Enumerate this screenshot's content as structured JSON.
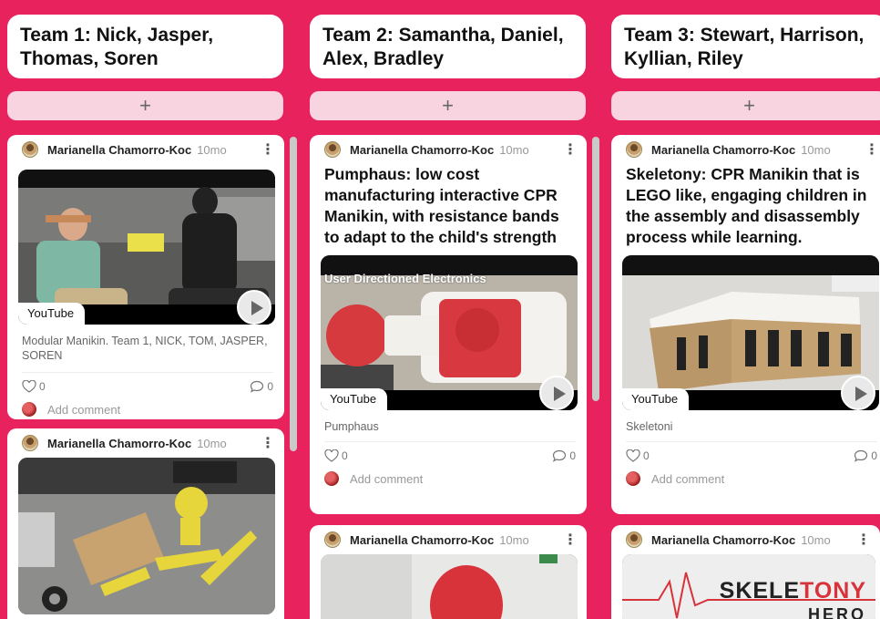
{
  "columns": [
    {
      "title": "Team 1: Nick, Jasper, Thomas, Soren",
      "add_label": "+",
      "posts": [
        {
          "author": "Marianella Chamorro-Koc",
          "time": "10mo",
          "menu": "⋮",
          "media_label": "YouTube",
          "caption": "Modular Manikin. Team 1, NICK, TOM, JASPER, SOREN",
          "likes": "0",
          "comments": "0",
          "add_comment": "Add comment"
        },
        {
          "author": "Marianella Chamorro-Koc",
          "time": "10mo",
          "menu": "⋮"
        }
      ]
    },
    {
      "title": "Team 2: Samantha, Daniel, Alex, Bradley",
      "add_label": "+",
      "posts": [
        {
          "author": "Marianella Chamorro-Koc",
          "time": "10mo",
          "menu": "⋮",
          "title": "Pumphaus: low cost manufacturing interactive CPR Manikin, with resistance bands to adapt to the child's strength",
          "media_overlay": "User Directioned Electronics",
          "media_label": "YouTube",
          "caption": "Pumphaus",
          "likes": "0",
          "comments": "0",
          "add_comment": "Add comment"
        },
        {
          "author": "Marianella Chamorro-Koc",
          "time": "10mo",
          "menu": "⋮"
        }
      ]
    },
    {
      "title": "Team 3: Stewart, Harrison, Kyllian, Riley",
      "add_label": "+",
      "posts": [
        {
          "author": "Marianella Chamorro-Koc",
          "time": "10mo",
          "menu": "⋮",
          "title": "Skeletony: CPR Manikin that is LEGO like, engaging children in the assembly and disassembly process while learning.",
          "media_label": "YouTube",
          "caption": "Skeletoni",
          "likes": "0",
          "comments": "0",
          "add_comment": "Add comment"
        },
        {
          "author": "Marianella Chamorro-Koc",
          "time": "10mo",
          "menu": "⋮",
          "logo_main": "SKELE",
          "logo_accent": "TONY",
          "logo_sub": "HERO"
        }
      ]
    }
  ],
  "colors": {
    "background": "#e8225d",
    "add_bar": "#f8d3e0",
    "card": "#ffffff"
  }
}
